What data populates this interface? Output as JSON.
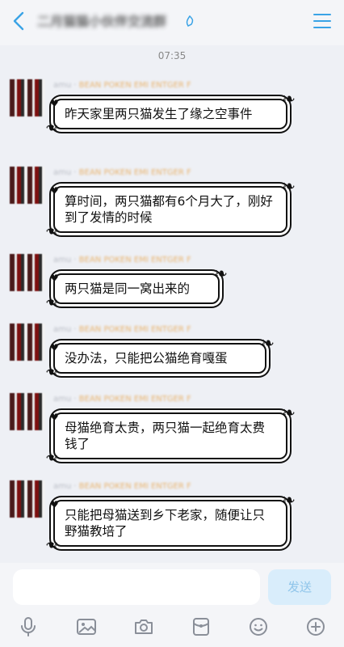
{
  "header": {
    "title": "二月猫猫小伙伴交流群",
    "back_icon": "chevron-left-icon",
    "menu_icon": "hamburger-menu-icon"
  },
  "timestamp": "07:35",
  "messages": [
    {
      "sender": "amu ·",
      "sender_tag": "BEAN POKEN EMI ENTGER F",
      "text": "昨天家里两只猫发生了缘之空事件"
    },
    {
      "sender": "amu ·",
      "sender_tag": "BEAN POKEN EMI ENTGER F",
      "text": "算时间，两只猫都有6个月大了，刚好到了发情的时候"
    },
    {
      "sender": "amu ·",
      "sender_tag": "BEAN POKEN EMI ENTGER F",
      "text": "两只猫是同一窝出来的"
    },
    {
      "sender": "amu ·",
      "sender_tag": "BEAN POKEN EMI ENTGER F",
      "text": "没办法，只能把公猫绝育嘎蛋"
    },
    {
      "sender": "amu ·",
      "sender_tag": "BEAN POKEN EMI ENTGER F",
      "text": "母猫绝育太贵，两只猫一起绝育太费钱了"
    },
    {
      "sender": "amu ·",
      "sender_tag": "BEAN POKEN EMI ENTGER F",
      "text": "只能把母猫送到乡下老家，随便让只野猫教培了"
    }
  ],
  "composer": {
    "placeholder": "",
    "send_label": "发送"
  },
  "toolbar_icons": [
    "microphone-icon",
    "image-icon",
    "camera-icon",
    "red-packet-icon",
    "emoji-icon",
    "plus-icon"
  ],
  "colors": {
    "accent": "#3aa3e6",
    "send_bg": "#d9edfb",
    "send_text": "#8fc5ea"
  }
}
